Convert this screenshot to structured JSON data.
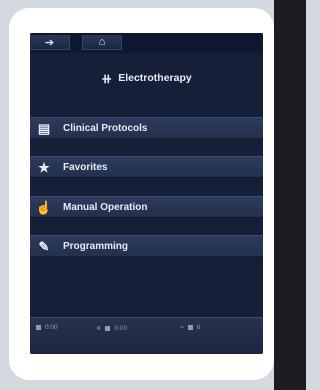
{
  "topbar": {
    "back_icon": "back-arrow-icon",
    "home_icon": "home-icon"
  },
  "header": {
    "title": "Electrotherapy",
    "icon": "electrodes-icon"
  },
  "menu": {
    "items": [
      {
        "label": "Clinical Protocols",
        "icon": "document-icon"
      },
      {
        "label": "Favorites",
        "icon": "star-icon"
      },
      {
        "label": "Manual Operation",
        "icon": "hand-pointer-icon"
      },
      {
        "label": "Programming",
        "icon": "edit-document-icon"
      }
    ]
  },
  "bottombar": {
    "channel1_time": "0:00",
    "channel2_time": "0:00",
    "channel3_label": "6"
  }
}
